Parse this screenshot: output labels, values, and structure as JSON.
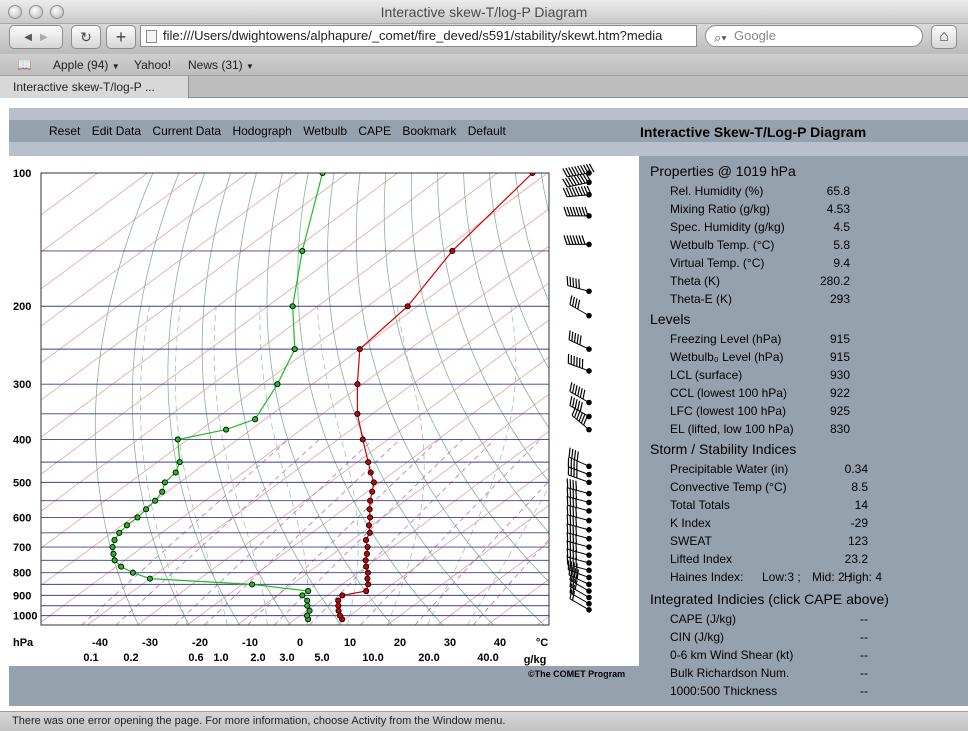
{
  "window": {
    "title": "Interactive skew-T/log-P Diagram"
  },
  "toolbar": {
    "url": "file:///Users/dwightowens/alphapure/_comet/fire_deved/s591/stability/skewt.htm?media",
    "search_placeholder": "Google",
    "back_glyph": "◀",
    "forward_glyph": "▶",
    "reload_glyph": "↻",
    "add_glyph": "+",
    "home_glyph": "⌂"
  },
  "bookmarks": [
    {
      "label": "Apple (94)",
      "dropdown": true
    },
    {
      "label": "Yahoo!",
      "dropdown": false
    },
    {
      "label": "News (31)",
      "dropdown": true
    }
  ],
  "tab": {
    "label": "Interactive skew-T/log-P ..."
  },
  "menu": [
    "Reset",
    "Edit Data",
    "Current Data",
    "Hodograph",
    "Wetbulb",
    "CAPE",
    "Bookmark",
    "Default"
  ],
  "diagram_title": "Interactive Skew-T/Log-P Diagram",
  "copyright": "©The COMET Program",
  "properties": {
    "heading": "Properties @ 1019 hPa",
    "rows": [
      {
        "label": "Rel. Humidity (%)",
        "value": "65.8"
      },
      {
        "label": "Mixing Ratio (g/kg)",
        "value": "4.53"
      },
      {
        "label": "Spec. Humidity (g/kg)",
        "value": "4.5"
      },
      {
        "label": "Wetbulb Temp. (°C)",
        "value": "5.8"
      },
      {
        "label": "Virtual Temp. (°C)",
        "value": "9.4"
      },
      {
        "label": "Theta (K)",
        "value": "280.2"
      },
      {
        "label": "Theta-E (K)",
        "value": "293"
      }
    ]
  },
  "levels": {
    "heading": "Levels",
    "rows": [
      {
        "label": "Freezing Level (hPa)",
        "value": "915"
      },
      {
        "label": "Wetbulb₀ Level (hPa)",
        "value": "915"
      },
      {
        "label": "LCL (surface)",
        "value": "930"
      },
      {
        "label": "CCL (lowest 100 hPa)",
        "value": "922"
      },
      {
        "label": "LFC (lowest 100 hPa)",
        "value": "925"
      },
      {
        "label": "EL (lifted, low 100 hPa)",
        "value": "830"
      }
    ]
  },
  "indices": {
    "heading": "Storm / Stability Indices",
    "rows": [
      {
        "label": "Precipitable Water (in)",
        "value": "0.34"
      },
      {
        "label": "Convective Temp (°C)",
        "value": "8.5"
      },
      {
        "label": "Total Totals",
        "value": "14"
      },
      {
        "label": "K Index",
        "value": "-29"
      },
      {
        "label": "SWEAT",
        "value": "123"
      },
      {
        "label": "Lifted Index",
        "value": "23.2"
      }
    ],
    "haines": {
      "label": "Haines Index:",
      "low": "Low:3 ;",
      "mid": "Mid: 2 ;",
      "high": "High: 4"
    }
  },
  "integrated": {
    "heading": "Integrated Indicies (click CAPE above)",
    "rows": [
      {
        "label": "CAPE (J/kg)",
        "value": "--"
      },
      {
        "label": "CIN (J/kg)",
        "value": "--"
      },
      {
        "label": "0-6 km Wind Shear (kt)",
        "value": "--"
      },
      {
        "label": "Bulk Richardson Num.",
        "value": "--"
      },
      {
        "label": "1000:500 Thickness",
        "value": "--"
      }
    ]
  },
  "status_text": "There was one error opening the page. For more information, choose Activity from the Window menu.",
  "colors": {
    "temperature": "#cc0000",
    "dewpoint": "#22bb22",
    "isobar": "#3b3f8c",
    "isotherm": "#e8a0a0",
    "dry_adiabat": "#88b09a",
    "moist_adiabat": "#a6c0b4",
    "mixing_ratio": "#b07ab8",
    "frame": "#96a1ae"
  },
  "chart_data": {
    "type": "line",
    "title": "",
    "xlabel": "°C",
    "ylabel": "hPa",
    "xlim": [
      -40,
      40
    ],
    "ylim": [
      1050,
      100
    ],
    "log_y": true,
    "skewed": true,
    "pressure_ticks": [
      100,
      200,
      300,
      400,
      500,
      600,
      700,
      800,
      900,
      1000
    ],
    "temperature_ticks": [
      -40,
      -30,
      -20,
      -10,
      0,
      10,
      20,
      30,
      40
    ],
    "mixing_ratio_ticks": [
      "0.1",
      "0.2",
      "0.6",
      "1.0",
      "2.0",
      "3.0",
      "5.0",
      "10.0",
      "20.0",
      "40.0"
    ],
    "mixing_ratio_unit": "g/kg",
    "series": [
      {
        "name": "",
        "role": "temperature",
        "p": [
          1019,
          1000,
          975,
          950,
          925,
          900,
          880,
          850,
          825,
          800,
          775,
          750,
          725,
          700,
          675,
          650,
          625,
          600,
          575,
          550,
          525,
          500,
          475,
          450,
          400,
          350,
          300,
          250,
          200,
          150,
          100
        ],
        "t": [
          9.4,
          8.0,
          6.4,
          5.0,
          3.6,
          3.0,
          6.6,
          5.2,
          3.5,
          2.0,
          0.0,
          -1.8,
          -3.3,
          -5.0,
          -7.2,
          -8.4,
          -10.6,
          -12.5,
          -14.8,
          -17.0,
          -19.0,
          -21.2,
          -24.5,
          -27.8,
          -35.0,
          -43.0,
          -51.0,
          -60.0,
          -62.0,
          -68.0,
          -73.0
        ]
      },
      {
        "name": "",
        "role": "dewpoint",
        "p": [
          1019,
          1000,
          975,
          950,
          925,
          900,
          880,
          850,
          825,
          800,
          775,
          750,
          725,
          700,
          675,
          650,
          625,
          600,
          575,
          550,
          525,
          500,
          475,
          450,
          400,
          380,
          360,
          300,
          250,
          200,
          150,
          100
        ],
        "t": [
          2.6,
          1.4,
          0.6,
          -1.2,
          -2.6,
          -5.0,
          -5.0,
          -18.0,
          -40.0,
          -45.0,
          -49.0,
          -52.0,
          -54.0,
          -56.0,
          -57.5,
          -58.5,
          -59.0,
          -59.0,
          -59.5,
          -60.0,
          -61.0,
          -63.0,
          -63.5,
          -65.5,
          -72.0,
          -65.0,
          -62.0,
          -67.0,
          -73.0,
          -85.0,
          -98.0,
          -115.0
        ]
      }
    ],
    "winds": [
      {
        "p": 100,
        "dir": 260,
        "spd": 100
      },
      {
        "p": 105,
        "dir": 258,
        "spd": 95
      },
      {
        "p": 112,
        "dir": 265,
        "spd": 95
      },
      {
        "p": 125,
        "dir": 270,
        "spd": 80
      },
      {
        "p": 145,
        "dir": 270,
        "spd": 75
      },
      {
        "p": 185,
        "dir": 285,
        "spd": 50
      },
      {
        "p": 210,
        "dir": 300,
        "spd": 45
      },
      {
        "p": 250,
        "dir": 295,
        "spd": 55
      },
      {
        "p": 280,
        "dir": 290,
        "spd": 60
      },
      {
        "p": 330,
        "dir": 300,
        "spd": 60
      },
      {
        "p": 355,
        "dir": 300,
        "spd": 55
      },
      {
        "p": 380,
        "dir": 310,
        "spd": 60
      },
      {
        "p": 460,
        "dir": 295,
        "spd": 40
      },
      {
        "p": 480,
        "dir": 290,
        "spd": 40
      },
      {
        "p": 500,
        "dir": 290,
        "spd": 40
      },
      {
        "p": 530,
        "dir": 285,
        "spd": 40
      },
      {
        "p": 555,
        "dir": 285,
        "spd": 40
      },
      {
        "p": 580,
        "dir": 285,
        "spd": 40
      },
      {
        "p": 610,
        "dir": 285,
        "spd": 40
      },
      {
        "p": 640,
        "dir": 285,
        "spd": 40
      },
      {
        "p": 670,
        "dir": 285,
        "spd": 40
      },
      {
        "p": 700,
        "dir": 285,
        "spd": 40
      },
      {
        "p": 730,
        "dir": 285,
        "spd": 40
      },
      {
        "p": 760,
        "dir": 285,
        "spd": 40
      },
      {
        "p": 790,
        "dir": 285,
        "spd": 40
      },
      {
        "p": 820,
        "dir": 290,
        "spd": 40
      },
      {
        "p": 850,
        "dir": 295,
        "spd": 40
      },
      {
        "p": 880,
        "dir": 300,
        "spd": 35
      },
      {
        "p": 910,
        "dir": 300,
        "spd": 30
      },
      {
        "p": 940,
        "dir": 300,
        "spd": 25
      },
      {
        "p": 970,
        "dir": 300,
        "spd": 20
      }
    ]
  }
}
